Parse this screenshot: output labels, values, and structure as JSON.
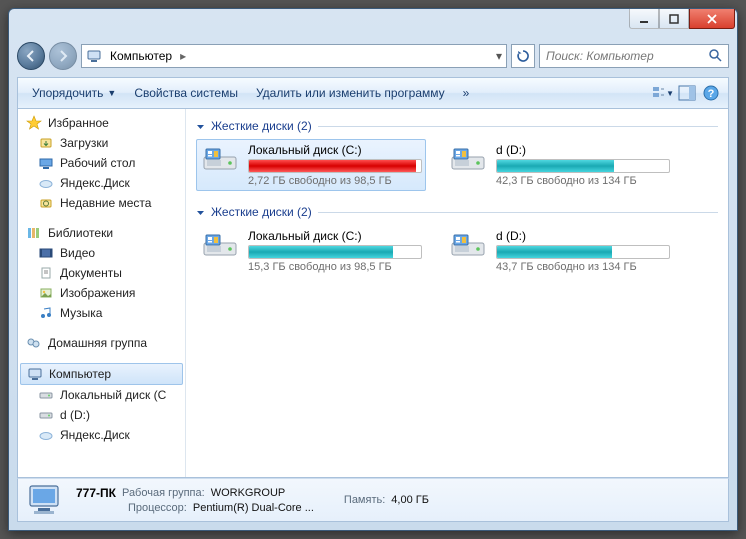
{
  "titlebar": {},
  "nav": {
    "location_icon": "computer",
    "crumb1": "Компьютер",
    "search_placeholder": "Поиск: Компьютер"
  },
  "toolbar": {
    "organize": "Упорядочить",
    "props": "Свойства системы",
    "uninstall": "Удалить или изменить программу",
    "overflow": "»"
  },
  "sidebar": {
    "favorites": {
      "label": "Избранное",
      "items": [
        "Загрузки",
        "Рабочий стол",
        "Яндекс.Диск",
        "Недавние места"
      ]
    },
    "libraries": {
      "label": "Библиотеки",
      "items": [
        "Видео",
        "Документы",
        "Изображения",
        "Музыка"
      ]
    },
    "homegroup": {
      "label": "Домашняя группа"
    },
    "computer": {
      "label": "Компьютер",
      "items": [
        "Локальный диск (C",
        "d (D:)",
        "Яндекс.Диск"
      ]
    }
  },
  "content": {
    "group1": {
      "label": "Жесткие диски (2)",
      "drives": [
        {
          "name": "Локальный диск (C:)",
          "free": "2,72 ГБ свободно из 98,5 ГБ",
          "pct": 97,
          "color": "red",
          "selected": true
        },
        {
          "name": "d (D:)",
          "free": "42,3 ГБ свободно из 134 ГБ",
          "pct": 68,
          "color": "teal",
          "selected": false
        }
      ]
    },
    "group2": {
      "label": "Жесткие диски (2)",
      "drives": [
        {
          "name": "Локальный диск (C:)",
          "free": "15,3 ГБ свободно из 98,5 ГБ",
          "pct": 84,
          "color": "teal",
          "selected": false
        },
        {
          "name": "d (D:)",
          "free": "43,7 ГБ свободно из 134 ГБ",
          "pct": 67,
          "color": "teal",
          "selected": false
        }
      ]
    }
  },
  "details": {
    "name": "777-ПК",
    "wg_key": "Рабочая группа:",
    "wg_val": "WORKGROUP",
    "mem_key": "Память:",
    "mem_val": "4,00 ГБ",
    "cpu_key": "Процессор:",
    "cpu_val": "Pentium(R) Dual-Core  ..."
  }
}
